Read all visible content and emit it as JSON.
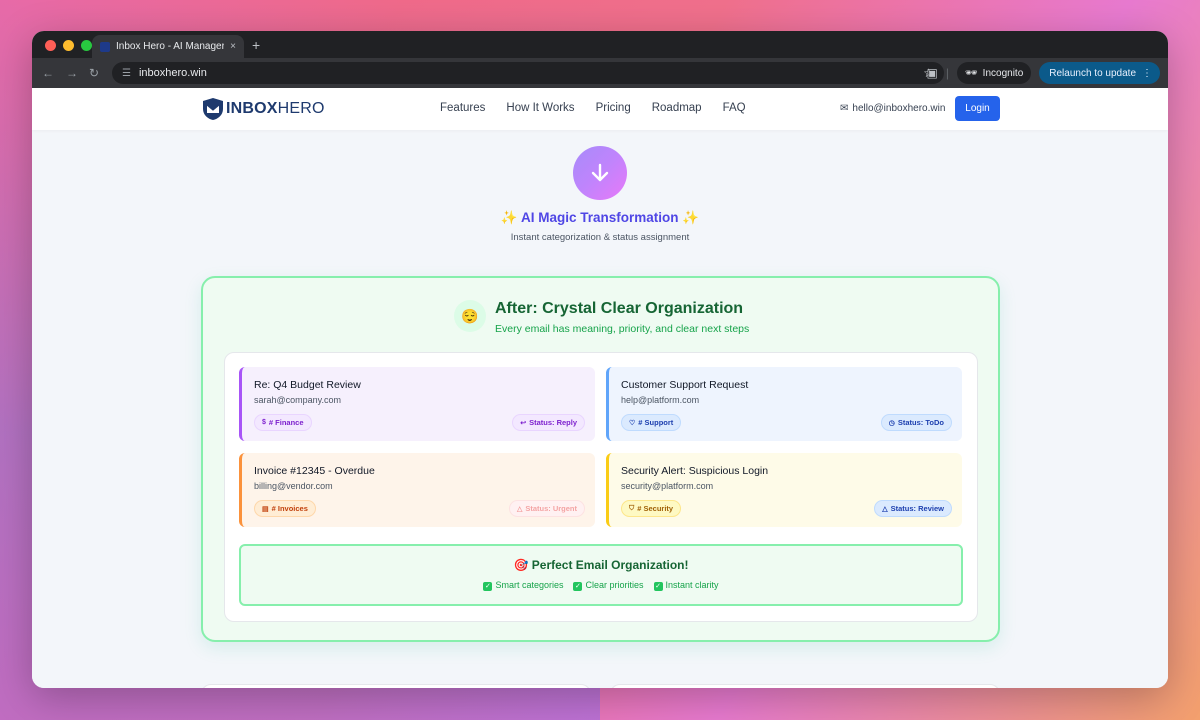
{
  "browser": {
    "tab_title": "Inbox Hero - AI Manager for M",
    "tab_close": "×",
    "new_tab": "+",
    "url": "inboxhero.win",
    "incognito_label": "Incognito",
    "relaunch_label": "Relaunch to update",
    "menu_icon": "⋮"
  },
  "header": {
    "logo_bold": "INBOX",
    "logo_light": "HERO",
    "nav": [
      "Features",
      "How It Works",
      "Pricing",
      "Roadmap",
      "FAQ"
    ],
    "contact_email": "hello@inboxhero.win",
    "login_label": "Login"
  },
  "hero": {
    "magic_title": "✨ AI Magic Transformation ✨",
    "magic_sub": "Instant categorization & status assignment"
  },
  "after": {
    "emoji": "😌",
    "title": "After: Crystal Clear Organization",
    "subtitle": "Every email has meaning, priority, and clear next steps",
    "emails": [
      {
        "subject": "Re: Q4 Budget Review",
        "from": "sarah@company.com",
        "category": "# Finance",
        "category_icon": "$",
        "status": "Status: Reply",
        "status_icon": "↩"
      },
      {
        "subject": "Customer Support Request",
        "from": "help@platform.com",
        "category": "# Support",
        "category_icon": "♡",
        "status": "Status: ToDo",
        "status_icon": "◷"
      },
      {
        "subject": "Invoice #12345 - Overdue",
        "from": "billing@vendor.com",
        "category": "# Invoices",
        "category_icon": "▤",
        "status": "Status: Urgent",
        "status_icon": "△"
      },
      {
        "subject": "Security Alert: Suspicious Login",
        "from": "security@platform.com",
        "category": "# Security",
        "category_icon": "⛉",
        "status": "Status: Review",
        "status_icon": "△"
      }
    ],
    "perfect_title": "🎯 Perfect Email Organization!",
    "perfect_items": [
      "Smart categories",
      "Clear priorities",
      "Instant clarity"
    ]
  },
  "colors": {
    "accent": "#2563eb",
    "brand": "#1e3a6e",
    "success": "#16a34a",
    "magic": "#4f46e5"
  }
}
